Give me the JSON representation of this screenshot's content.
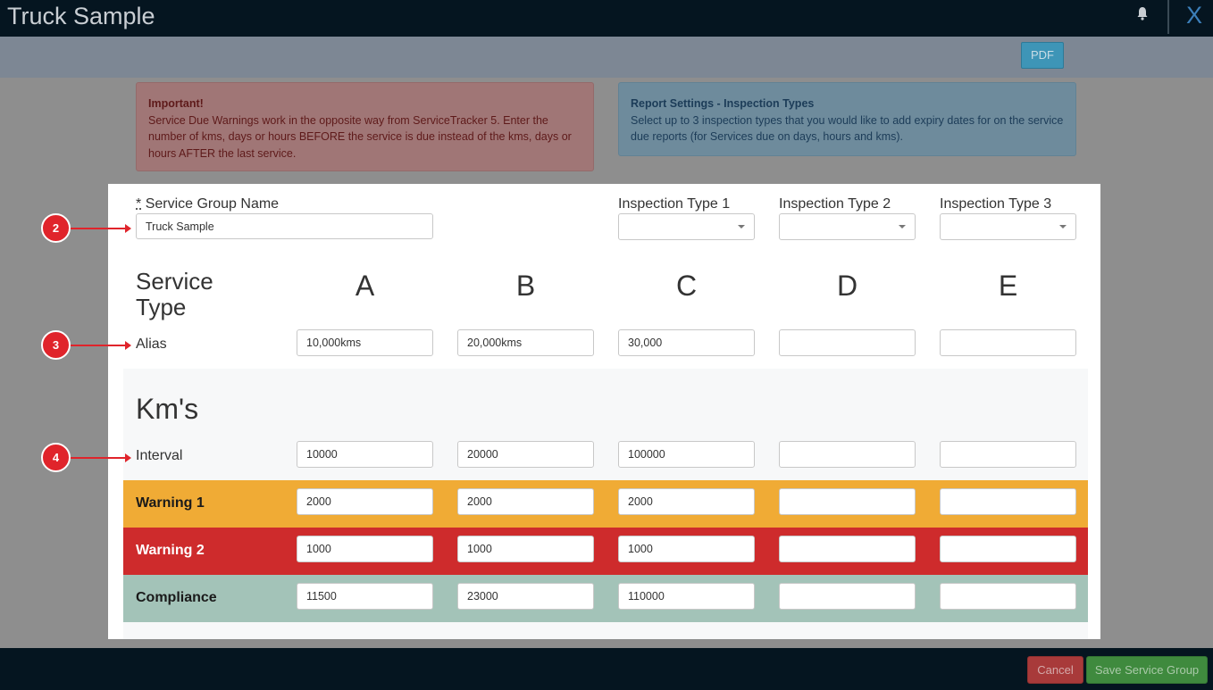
{
  "window": {
    "title": "Truck Sample",
    "close_label": "X"
  },
  "toolbar": {
    "pdf_label": "PDF"
  },
  "alerts": {
    "important_title": "Important!",
    "important_text": "Service Due Warnings work in the opposite way from ServiceTracker 5. Enter the number of kms, days or hours BEFORE the service is due instead of the kms, days or hours AFTER the last service.",
    "report_title": "Report Settings - Inspection Types",
    "report_text": "Select up to 3 inspection types that you would like to add expiry dates for on the service due reports (for Services due on days, hours and kms)."
  },
  "form": {
    "required_mark": "*",
    "group_name_label": "Service Group Name",
    "group_name_value": "Truck Sample",
    "inspection_labels": [
      "Inspection Type 1",
      "Inspection Type 2",
      "Inspection Type 3"
    ],
    "inspection_values": [
      "",
      "",
      ""
    ]
  },
  "grid": {
    "service_type_label": "Service Type",
    "columns": [
      "A",
      "B",
      "C",
      "D",
      "E"
    ],
    "alias_label": "Alias",
    "alias_values": [
      "10,000kms",
      "20,000kms",
      "30,000",
      "",
      ""
    ],
    "section_title": "Km's",
    "interval_label": "Interval",
    "interval_values": [
      "10000",
      "20000",
      "100000",
      "",
      ""
    ],
    "warning1_label": "Warning 1",
    "warning1_values": [
      "2000",
      "2000",
      "2000",
      "",
      ""
    ],
    "warning2_label": "Warning 2",
    "warning2_values": [
      "1000",
      "1000",
      "1000",
      "",
      ""
    ],
    "compliance_label": "Compliance",
    "compliance_values": [
      "11500",
      "23000",
      "110000",
      "",
      ""
    ]
  },
  "colors": {
    "warning1": "#f0ab35",
    "warning2": "#ce2b2c",
    "compliance": "#a3c3b8",
    "callout": "#e0242b"
  },
  "callouts": [
    "2",
    "3",
    "4"
  ],
  "footer": {
    "cancel_label": "Cancel",
    "save_label": "Save Service Group"
  }
}
